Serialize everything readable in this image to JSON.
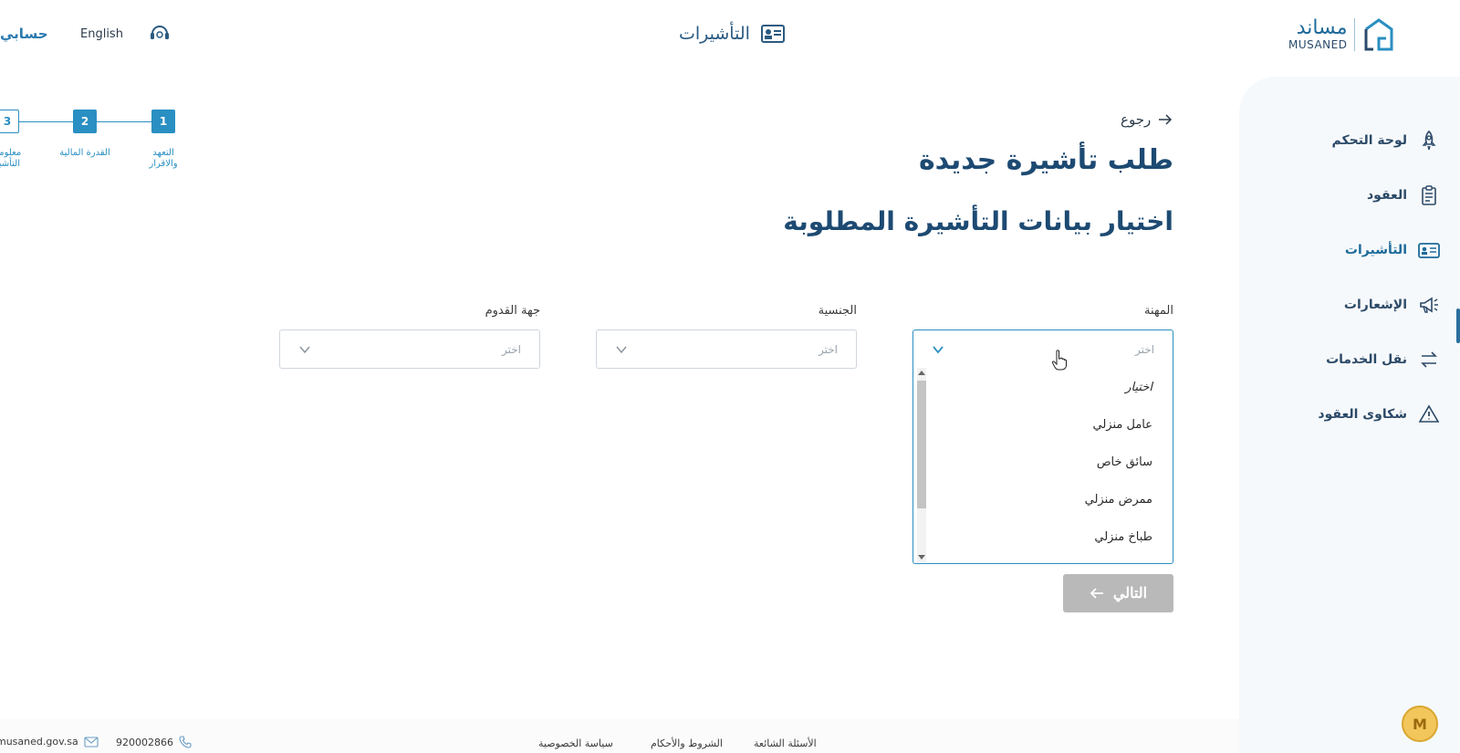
{
  "brand": {
    "name_ar": "مساند",
    "name_en": "MUSANED"
  },
  "header": {
    "title": "التأشيرات",
    "language_link": "English",
    "account_link": "حسابي"
  },
  "sidebar": {
    "items": [
      {
        "label": "لوحة التحكم",
        "icon": "rocket-icon"
      },
      {
        "label": "العقود",
        "icon": "clipboard-icon"
      },
      {
        "label": "التأشيرات",
        "icon": "id-card-icon",
        "active": true
      },
      {
        "label": "الإشعارات",
        "icon": "megaphone-icon"
      },
      {
        "label": "نقل الخدمات",
        "icon": "transfer-icon"
      },
      {
        "label": "شكاوى العقود",
        "icon": "warning-icon"
      }
    ]
  },
  "stepper": {
    "steps": [
      {
        "number": "1",
        "label_line1": "التعهد",
        "label_line2": "والاقرار",
        "state": "done"
      },
      {
        "number": "2",
        "label_line1": "القدرة المالية",
        "label_line2": "",
        "state": "done"
      },
      {
        "number": "3",
        "label_line1": "معلومات",
        "label_line2": "التأشيرة",
        "state": "current"
      }
    ]
  },
  "main": {
    "back_label": "رجوع",
    "page_title": "طلب تأشيرة جديدة",
    "section_title": "اختيار بيانات التأشيرة المطلوبة",
    "fields": {
      "profession": {
        "label": "المهنة",
        "value": "اختر"
      },
      "nationality": {
        "label": "الجنسية",
        "value": "اختر"
      },
      "arrival": {
        "label": "جهة القدوم",
        "value": "اختر"
      }
    },
    "profession_options": [
      "اختيار",
      "عامل منزلي",
      "سائق خاص",
      "ممرض منزلي",
      "طباخ منزلي"
    ],
    "next_button": "التالي"
  },
  "footer": {
    "links": [
      "الأسئلة الشائعة",
      "الشروط والأحكام",
      "سياسة الخصوصية"
    ],
    "phone": "920002866",
    "email": "musaned.gov.sa"
  },
  "colors": {
    "primary": "#2a8fc2",
    "heading": "#1d4a72",
    "disabled": "#b9b9b9"
  }
}
